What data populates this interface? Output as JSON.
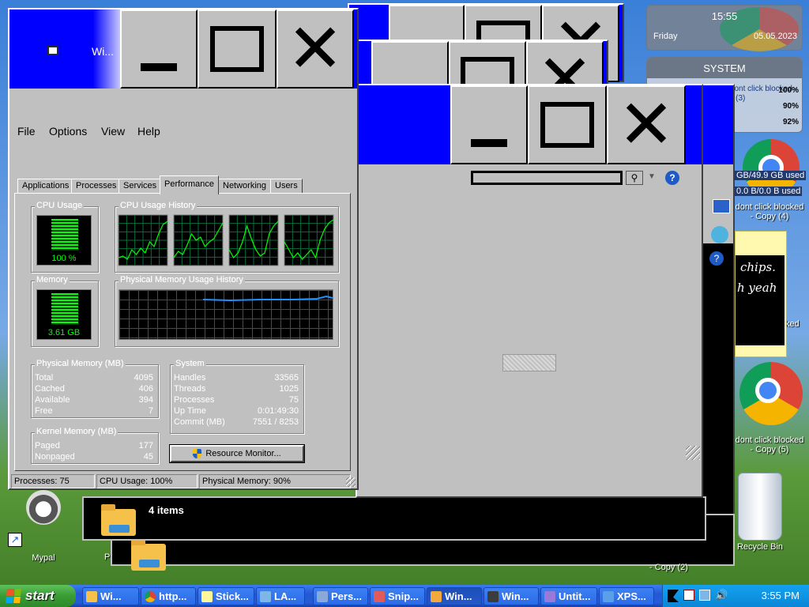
{
  "task_manager": {
    "title": "Wi...",
    "menu": [
      "File",
      "Options",
      "View",
      "Help"
    ],
    "tabs": [
      "Applications",
      "Processes",
      "Services",
      "Performance",
      "Networking",
      "Users"
    ],
    "active_tab": "Performance",
    "cpu_usage": {
      "label": "CPU Usage",
      "value": "100 %"
    },
    "cpu_history": {
      "label": "CPU Usage History"
    },
    "memory": {
      "label": "Memory",
      "value": "3.61 GB"
    },
    "memory_history": {
      "label": "Physical Memory Usage History"
    },
    "physical_memory": {
      "label": "Physical Memory (MB)",
      "rows": [
        {
          "k": "Total",
          "v": "4095"
        },
        {
          "k": "Cached",
          "v": "406"
        },
        {
          "k": "Available",
          "v": "394"
        },
        {
          "k": "Free",
          "v": "7"
        }
      ]
    },
    "system": {
      "label": "System",
      "rows": [
        {
          "k": "Handles",
          "v": "33565"
        },
        {
          "k": "Threads",
          "v": "1025"
        },
        {
          "k": "Processes",
          "v": "75"
        },
        {
          "k": "Up Time",
          "v": "0:01:49:30"
        },
        {
          "k": "Commit (MB)",
          "v": "7551 / 8253"
        }
      ]
    },
    "kernel_memory": {
      "label": "Kernel Memory (MB)",
      "rows": [
        {
          "k": "Paged",
          "v": "177"
        },
        {
          "k": "Nonpaged",
          "v": "45"
        }
      ]
    },
    "resource_monitor_button": "Resource Monitor...",
    "status": {
      "processes": "Processes: 75",
      "cpu": "CPU Usage: 100%",
      "memory": "Physical Memory: 90%"
    }
  },
  "explorer": {
    "items_count": "4 items"
  },
  "desktop": {
    "icons": {
      "mypal": "Mypal",
      "recycle": "Recycle Bin",
      "chrome_4": "dont click blocked - Copy (4)",
      "chrome_5": "dont click blocked - Copy (5)",
      "copy_2": "- Copy (2)",
      "copy_label": "vm! dont click blocked - Copy (3)",
      "p_cut": "P",
      "ked": "ked"
    },
    "sticky": {
      "line1": "chips.",
      "line2": "h yeah"
    }
  },
  "gadgets": {
    "clock_time": "15:55",
    "clock_day": "Friday",
    "clock_date": "05.05.2023",
    "system_title": "SYSTEM",
    "p1": "100%",
    "p2": "90%",
    "p3": "92%",
    "disk1": "GB/49.9 GB used",
    "disk2": "0.0 B/0.0 B used"
  },
  "taskbar": {
    "start": "start",
    "buttons": [
      "Wi...",
      "http...",
      "Stick...",
      "LA...",
      "Pers...",
      "Snip...",
      "Win...",
      "Win...",
      "Untit...",
      "XPS..."
    ],
    "clock": "3:55 PM"
  },
  "colors": {
    "titlebar": "#0000ff",
    "graph_line": "#00ff00",
    "memory_line": "#1e90ff"
  }
}
